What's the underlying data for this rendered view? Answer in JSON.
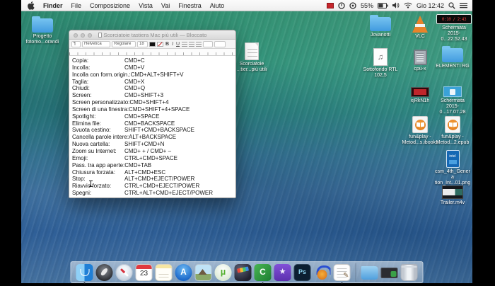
{
  "menu_bar": {
    "items": [
      "Finder",
      "File",
      "Composizione",
      "Vista",
      "Vai",
      "Finestra",
      "Aiuto"
    ],
    "status": {
      "battery": "55%",
      "clock": "Gio 12:42"
    }
  },
  "window": {
    "title": "Scorciatoie tastiera Mac più utili — Bloccato",
    "format_bar": {
      "styles": "¶",
      "font": "Helvetica",
      "weight": "Regolare",
      "size": "18",
      "bold": "B",
      "italic": "I",
      "underline": "U"
    },
    "shortcuts": [
      {
        "label": "Copia:",
        "keys": "CMD+C"
      },
      {
        "label": "Incolla:",
        "keys": "CMD+V"
      },
      {
        "label": "Incolla con form.origin.:",
        "keys": "CMD+ALT+SHIFT+V"
      },
      {
        "label": "Taglia:",
        "keys": "CMD+X"
      },
      {
        "label": "Chiudi:",
        "keys": "CMD+Q"
      },
      {
        "label": "Screen:",
        "keys": "CMD+SHIFT+3"
      },
      {
        "label": "Screen personalizzato:",
        "keys": "CMD+SHIFT+4"
      },
      {
        "label": "Screen di una finestra:",
        "keys": "CMD+SHIFT+4+SPACE"
      },
      {
        "label": "Spotlight:",
        "keys": "CMD+SPACE"
      },
      {
        "label": "Elimina file:",
        "keys": "CMD+BACKSPACE"
      },
      {
        "label": "Svuota cestino:",
        "keys": "SHIFT+CMD+BACKSPACE"
      },
      {
        "label": "Cancella parole intere:",
        "keys": "ALT+BACKSPACE"
      },
      {
        "label": "Nuova cartella:",
        "keys": "SHIFT+CMD+N"
      },
      {
        "label": "Zoom su Internet:",
        "keys": "CMD+ + / CMD+ –"
      },
      {
        "label": "Emoji:",
        "keys": "CTRL+CMD+SPACE"
      },
      {
        "label": "Pass. tra app aperte:",
        "keys": "CMD+TAB"
      },
      {
        "label": "Chiusura forzata:",
        "keys": "ALT+CMD+ESC"
      },
      {
        "label": "Stop:",
        "keys": "ALT+CMD+EJECT/POWER"
      },
      {
        "label": "Riavvio forzato:",
        "keys": "CTRL+CMD+EJECT/POWER"
      },
      {
        "label": "Spegni:",
        "keys": "CTRL+ALT+CMD+EJECT/POWER"
      }
    ]
  },
  "desktop": {
    "icons": [
      {
        "label": "Progetto fotomo...orandi",
        "type": "folder"
      },
      {
        "label": "Scorciatoie ...tier...più utili",
        "type": "document"
      },
      {
        "label": "Jovanotti",
        "type": "folder"
      },
      {
        "label": "Sottofondo RTL 102,5",
        "type": "audio-file"
      },
      {
        "label": "VLC",
        "type": "vlc-app"
      },
      {
        "label": "cpu-x",
        "type": "chip-image"
      },
      {
        "label": "xjRkN1h",
        "type": "image"
      },
      {
        "label": "fun&play - Metod...s.ibooks",
        "type": "ibooks-file"
      },
      {
        "label": "Schermata 2015-0...22.52.43",
        "type": "screenshot"
      },
      {
        "label": "ELEMENTI RG",
        "type": "folder"
      },
      {
        "label": "Schermata 2015-0...17.07.28",
        "type": "screenshot"
      },
      {
        "label": "fun&play - Metod...2.epub",
        "type": "epub-file"
      },
      {
        "label": "csm_4th_Genera tion_Int...01.png",
        "type": "image"
      },
      {
        "label": "Trailer.m4v",
        "type": "video"
      }
    ],
    "timer_thumbnail": "0:10 / 2:43"
  },
  "dock": {
    "items": [
      "Finder",
      "Launchpad",
      "Safari",
      "Calendario",
      "Note",
      "App Store",
      "Anteprima",
      "uTorrent",
      "Final Cut Pro",
      "Camtasia",
      "iMovie",
      "Photoshop",
      "Audio",
      "TextEdit",
      "Download",
      "Documenti",
      "Cestino"
    ],
    "calendar_day": "23",
    "accent_colors": {
      "folder_blue": "#5aa7e0",
      "camtasia_green": "#2f9e3f",
      "record_red": "#c5262c"
    }
  }
}
